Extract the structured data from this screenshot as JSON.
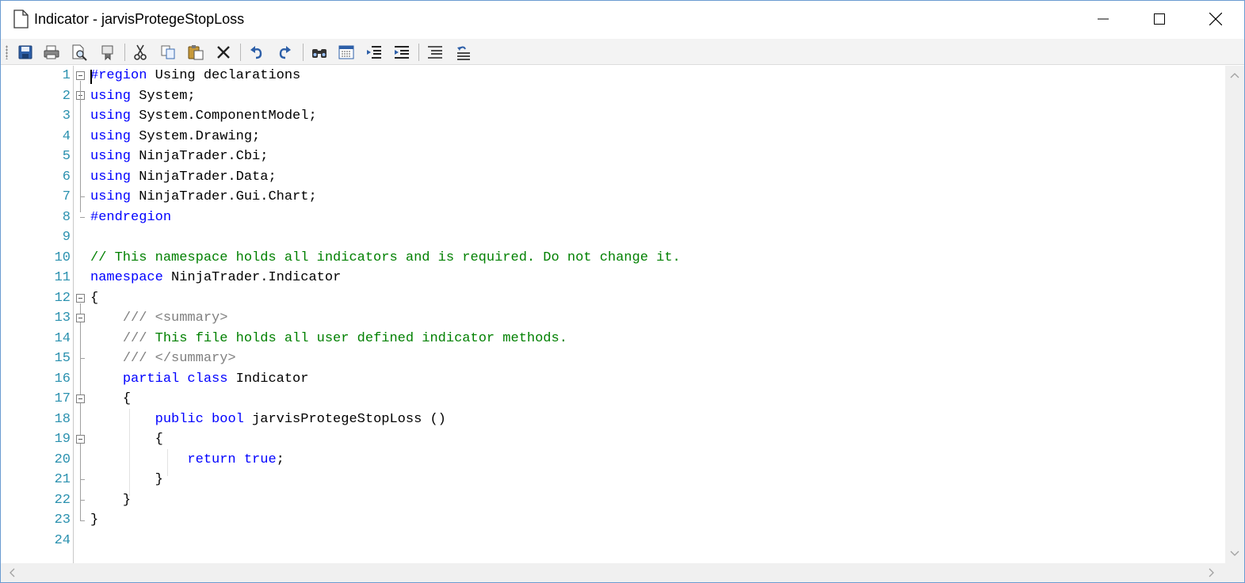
{
  "window": {
    "title": "Indicator - jarvisProtegeStopLoss"
  },
  "toolbar": {
    "buttons": [
      {
        "icon": "save-icon"
      },
      {
        "icon": "print-icon"
      },
      {
        "icon": "print-preview-icon"
      },
      {
        "icon": "page-setup-icon"
      },
      {
        "icon": "cut-icon"
      },
      {
        "icon": "copy-icon"
      },
      {
        "icon": "paste-icon"
      },
      {
        "icon": "delete-icon"
      },
      {
        "icon": "undo-icon"
      },
      {
        "icon": "redo-icon"
      },
      {
        "icon": "find-icon"
      },
      {
        "icon": "replace-icon"
      },
      {
        "icon": "outdent-icon"
      },
      {
        "icon": "indent-icon"
      },
      {
        "icon": "line-numbers-icon"
      },
      {
        "icon": "word-wrap-icon"
      }
    ]
  },
  "editor": {
    "lines": [
      {
        "n": "1",
        "kw": "#region",
        "rest": " Using declarations"
      },
      {
        "n": "2",
        "kw": "using",
        "rest": " System;"
      },
      {
        "n": "3",
        "kw": "using",
        "rest": " System.ComponentModel;"
      },
      {
        "n": "4",
        "kw": "using",
        "rest": " System.Drawing;"
      },
      {
        "n": "5",
        "kw": "using",
        "rest": " NinjaTrader.Cbi;"
      },
      {
        "n": "6",
        "kw": "using",
        "rest": " NinjaTrader.Data;"
      },
      {
        "n": "7",
        "kw": "using",
        "rest": " NinjaTrader.Gui.Chart;"
      },
      {
        "n": "8",
        "kw": "#endregion",
        "rest": ""
      },
      {
        "n": "9"
      },
      {
        "n": "10",
        "comment": "// This namespace holds all indicators and is required. Do not change it."
      },
      {
        "n": "11",
        "kw": "namespace",
        "rest": " NinjaTrader.Indicator"
      },
      {
        "n": "12",
        "plain": "{"
      },
      {
        "n": "13",
        "indent": "    ",
        "doc": "/// <summary>"
      },
      {
        "n": "14",
        "indent": "    ",
        "doc": "/// ",
        "comment": "This file holds all user defined indicator methods."
      },
      {
        "n": "15",
        "indent": "    ",
        "doc": "/// </summary>"
      },
      {
        "n": "16",
        "indent": "    ",
        "kw": "partial class",
        "rest": " Indicator"
      },
      {
        "n": "17",
        "indent": "    ",
        "plain": "{"
      },
      {
        "n": "18",
        "indent": "        ",
        "kw": "public bool",
        "rest": " jarvisProtegeStopLoss ()"
      },
      {
        "n": "19",
        "indent": "        ",
        "plain": "{"
      },
      {
        "n": "20",
        "indent": "            ",
        "kw": "return true",
        "rest": ";"
      },
      {
        "n": "21",
        "indent": "        ",
        "plain": "}"
      },
      {
        "n": "22",
        "indent": "    ",
        "plain": "}"
      },
      {
        "n": "23",
        "plain": "}"
      },
      {
        "n": "24"
      }
    ]
  }
}
